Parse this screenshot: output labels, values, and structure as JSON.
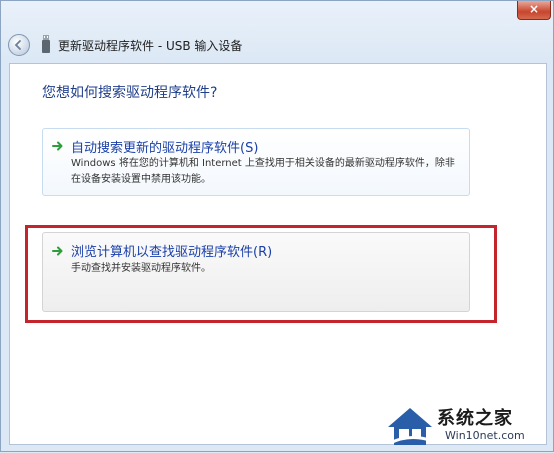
{
  "window": {
    "title": "更新驱动程序软件 - USB 输入设备",
    "close_label": "×"
  },
  "page": {
    "heading": "您想如何搜索驱动程序软件?"
  },
  "options": [
    {
      "title": "自动搜索更新的驱动程序软件(S)",
      "description": "Windows 将在您的计算机和 Internet 上查找用于相关设备的最新驱动程序软件，除非在设备安装设置中禁用该功能。"
    },
    {
      "title": "浏览计算机以查找驱动程序软件(R)",
      "description": "手动查找并安装驱动程序软件。"
    }
  ],
  "colors": {
    "highlight": "#c4252c",
    "link": "#1a3fa8",
    "arrow": "#2e9e3a"
  },
  "watermark": {
    "title": "系统之家",
    "subtitle": "Win10net.com"
  }
}
